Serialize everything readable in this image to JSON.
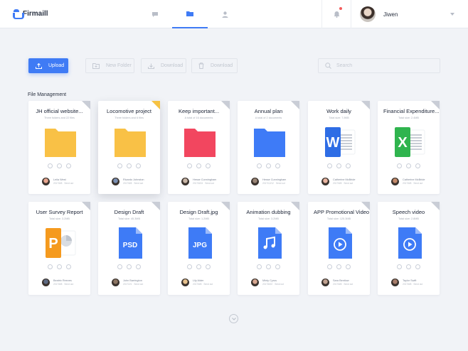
{
  "app": {
    "name": "Firmaill"
  },
  "nav": {
    "tabs": [
      {
        "icon": "chat-icon"
      },
      {
        "icon": "folder-icon"
      },
      {
        "icon": "user-icon"
      }
    ]
  },
  "header": {
    "user_name": "Jiwen"
  },
  "toolbar": {
    "upload": "Upload",
    "new_folder": "New Folder",
    "download1": "Download",
    "download2": "Download",
    "search_placeholder": "Search"
  },
  "section": {
    "title": "File Management"
  },
  "files": [
    {
      "title": "JH official website...",
      "sub": "Three folders and 22 files",
      "type": "folder",
      "color": "#f8c146",
      "owner": "Leila West",
      "date": "2017/8/8",
      "extra": "Send out"
    },
    {
      "title": "Locomotive project",
      "sub": "Three folders and 6 files",
      "type": "folder",
      "color": "#f8c146",
      "owner": "Ricardo Johnston",
      "date": "2017/8/8",
      "extra": "Send out"
    },
    {
      "title": "Keep important...",
      "sub": "A total of 16 documents",
      "type": "folder",
      "color": "#f24760",
      "owner": "Hesse Cunningham",
      "date": "2017/8/24",
      "extra": "Send out"
    },
    {
      "title": "Annual plan",
      "sub": "A total of 2 documents",
      "type": "folder",
      "color": "#3e7bf6",
      "owner": "Hesse Cunningham",
      "date": "2017/12/12",
      "extra": "Send out"
    },
    {
      "title": "Work daily",
      "sub": "Total size: 7.8KB",
      "type": "word",
      "color": "#2e6de5",
      "owner": "Catherine McBride",
      "date": "2017/8/8",
      "extra": "Send out"
    },
    {
      "title": "Financial Expenditure...",
      "sub": "Total size: 2.4MB",
      "type": "excel",
      "color": "#2fb44e",
      "owner": "Catherine McBride",
      "date": "2017/8/8",
      "extra": "Send out"
    },
    {
      "title": "User Survey Report",
      "sub": "Total size: 3.2MB",
      "type": "ppt",
      "color": "#f59a1e",
      "owner": "Beatrix Reeves",
      "date": "2017/8/8",
      "extra": "Send out"
    },
    {
      "title": "Design Draft",
      "sub": "Total size: 45.3MB",
      "type": "doc",
      "label": "PSD",
      "color": "#3e7bf6",
      "owner": "John Barrington",
      "date": "2017/2/1",
      "extra": "Send out"
    },
    {
      "title": "Design Draft.jpg",
      "sub": "Total size: 1.2MB",
      "type": "doc",
      "label": "JPG",
      "color": "#3e7bf6",
      "owner": "Lily Alder",
      "date": "2017/8/8",
      "extra": "Send out"
    },
    {
      "title": "Animation dubbing",
      "sub": "Total size: 3.2MB",
      "type": "doc",
      "label": "music",
      "color": "#3e7bf6",
      "owner": "Minty Cyrus",
      "date": "2017/8/22",
      "extra": "Send out"
    },
    {
      "title": "APP Promotional Video",
      "sub": "Total size: 125.3MB",
      "type": "doc",
      "label": "play",
      "color": "#3e7bf6",
      "owner": "Sara Bentlow",
      "date": "2017/8/8",
      "extra": "Send out"
    },
    {
      "title": "Speech video",
      "sub": "Total size: 2.8MB",
      "type": "doc",
      "label": "play",
      "color": "#3e7bf6",
      "owner": "Taylor Swift",
      "date": "2017/8/8",
      "extra": "Send out"
    }
  ],
  "colors": {
    "accent": "#3f7bf5",
    "folder_yellow": "#f8c146",
    "folder_red": "#f24760",
    "folder_blue": "#3e7bf6",
    "word": "#2e6de5",
    "excel": "#2fb44e",
    "ppt": "#f59a1e",
    "corner_gray": "#c9cdd6",
    "corner_yellow": "#f6c243"
  }
}
